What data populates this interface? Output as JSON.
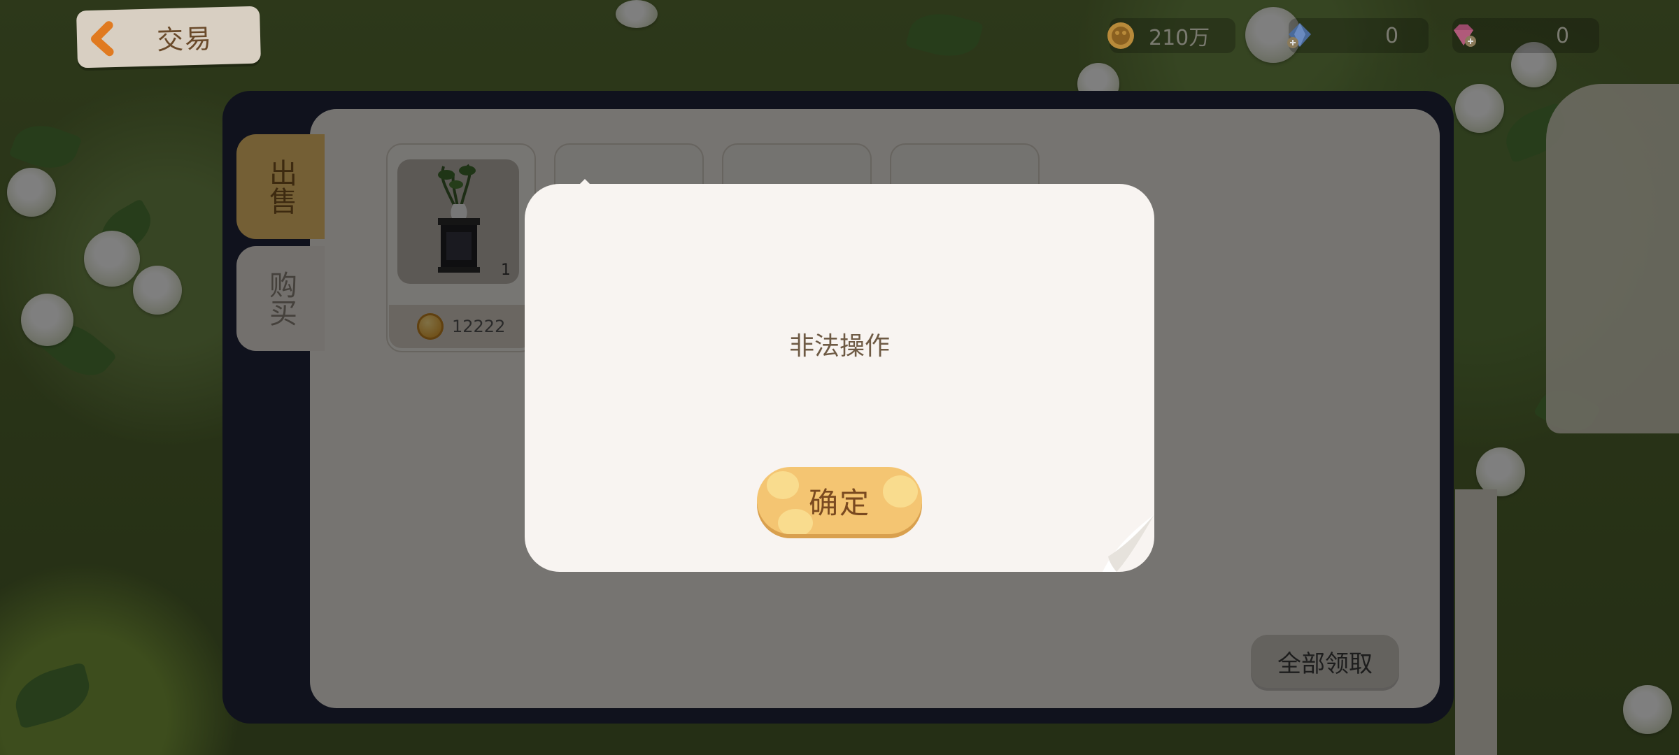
{
  "header": {
    "back_title": "交易",
    "resources": [
      {
        "icon": "gold-coin-icon",
        "value": "210万"
      },
      {
        "icon": "blue-gem-plus-icon",
        "value": "0"
      },
      {
        "icon": "pink-diamond-plus-icon",
        "value": "0"
      }
    ]
  },
  "tabs": {
    "sell": "出售",
    "buy": "购买",
    "active": "sell"
  },
  "listing": {
    "item_icon": "plant-stand-icon",
    "quantity": "1",
    "price": "12222"
  },
  "claim_all_label": "全部领取",
  "dialog": {
    "message": "非法操作",
    "confirm_label": "确定"
  },
  "colors": {
    "accent": "#f4c572",
    "tab_active": "#e8bf6a",
    "panel_frame": "#20253a",
    "dialog_bg": "#f8f4f1"
  }
}
